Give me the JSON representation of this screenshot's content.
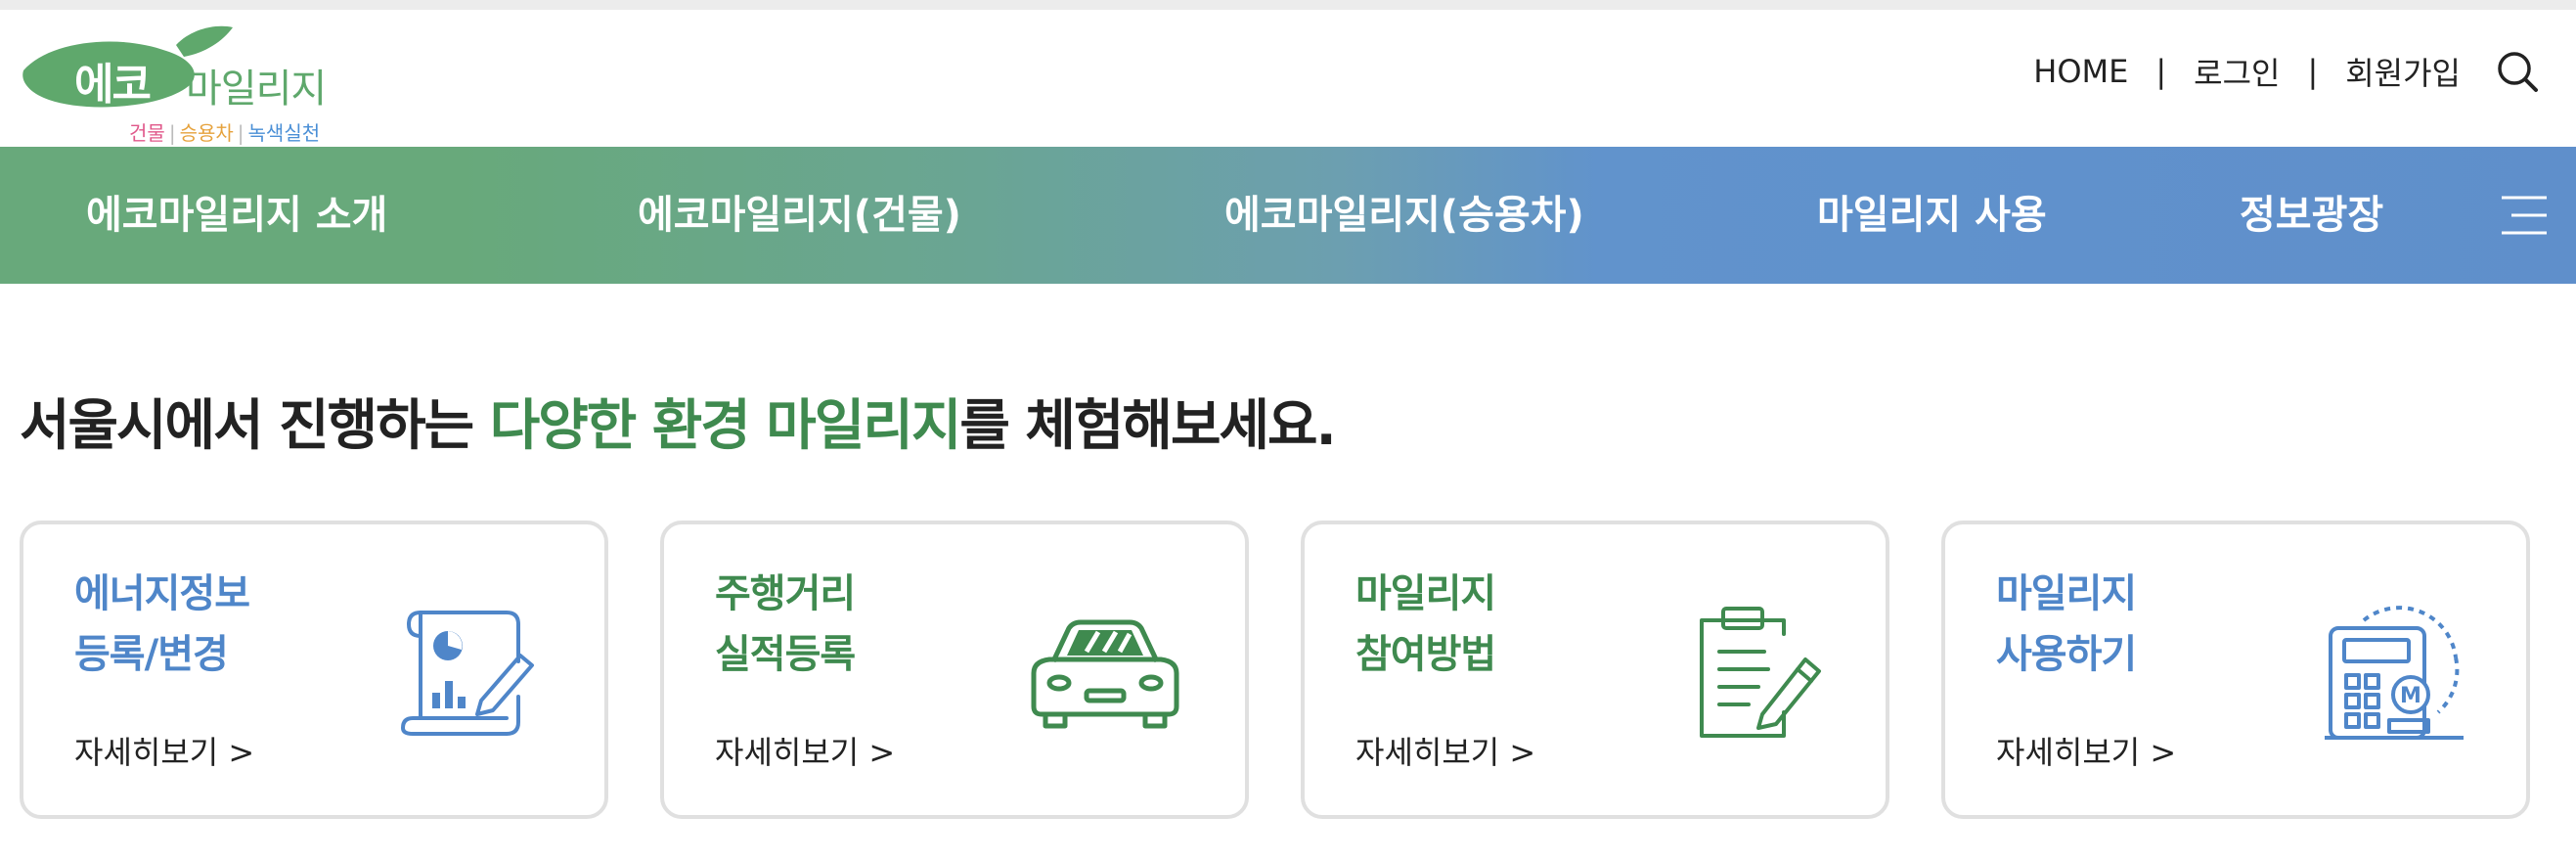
{
  "header": {
    "logo": {
      "eco": "에코",
      "mileage": "마일리지",
      "sub1": "건물",
      "sub2": "승용차",
      "sub3": "녹색실천",
      "sep": "|"
    },
    "util": {
      "home": "HOME",
      "login": "로그인",
      "signup": "회원가입",
      "separator": "|",
      "search_icon": "search-icon"
    }
  },
  "nav": {
    "items": [
      {
        "label": "에코마일리지 소개"
      },
      {
        "label": "에코마일리지(건물)"
      },
      {
        "label": "에코마일리지(승용차)"
      },
      {
        "label": "마일리지 사용"
      },
      {
        "label": "정보광장"
      }
    ],
    "menu_icon": "hamburger-menu-icon",
    "colors": {
      "green": "#68a97b",
      "blue": "#5f8fcb"
    }
  },
  "main": {
    "headline": {
      "pre": "서울시에서 진행하는 ",
      "highlight": "다양한 환경 마일리지",
      "post": "를 체험해보세요."
    },
    "cards": [
      {
        "line1": "에너지정보",
        "line2": "등록/변경",
        "more": "자세히보기 >",
        "icon": "energy-document-icon",
        "color": "#4f86c9"
      },
      {
        "line1": "주행거리",
        "line2": "실적등록",
        "more": "자세히보기 >",
        "icon": "car-icon",
        "color": "#3f8a4f"
      },
      {
        "line1": "마일리지",
        "line2": "참여방법",
        "more": "자세히보기 >",
        "icon": "clipboard-icon",
        "color": "#3f8a4f"
      },
      {
        "line1": "마일리지",
        "line2": "사용하기",
        "more": "자세히보기 >",
        "icon": "calculator-icon",
        "color": "#4f86c9"
      }
    ]
  }
}
